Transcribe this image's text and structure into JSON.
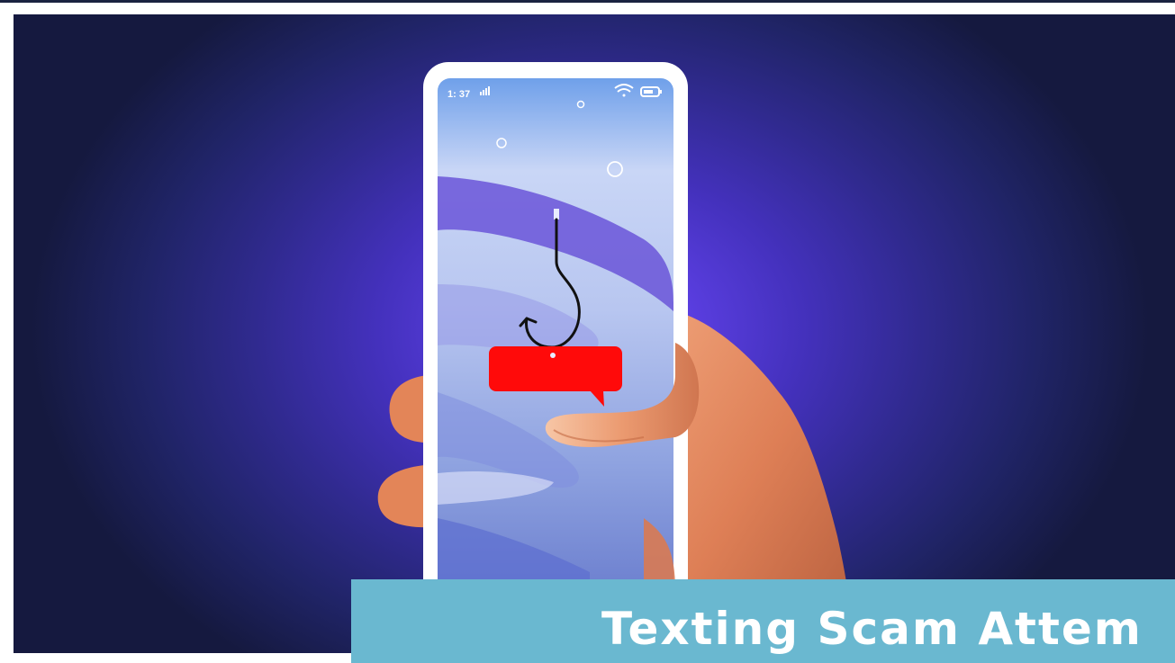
{
  "phone": {
    "status_time": "1: 37",
    "status_icons": [
      "signal-bars-icon",
      "wifi-icon",
      "battery-icon"
    ]
  },
  "illustration": {
    "subject": "hand holding smartphone with fishing hook dangling a red message bubble",
    "colors": {
      "background_center": "#6a48f0",
      "background_edge": "#15193f",
      "bubble": "#ff0a0a",
      "skin": "#e0835a",
      "phone_frame": "#ffffff"
    }
  },
  "caption": {
    "text": "Texting Scam Attem",
    "background": "#6ab8d0"
  }
}
